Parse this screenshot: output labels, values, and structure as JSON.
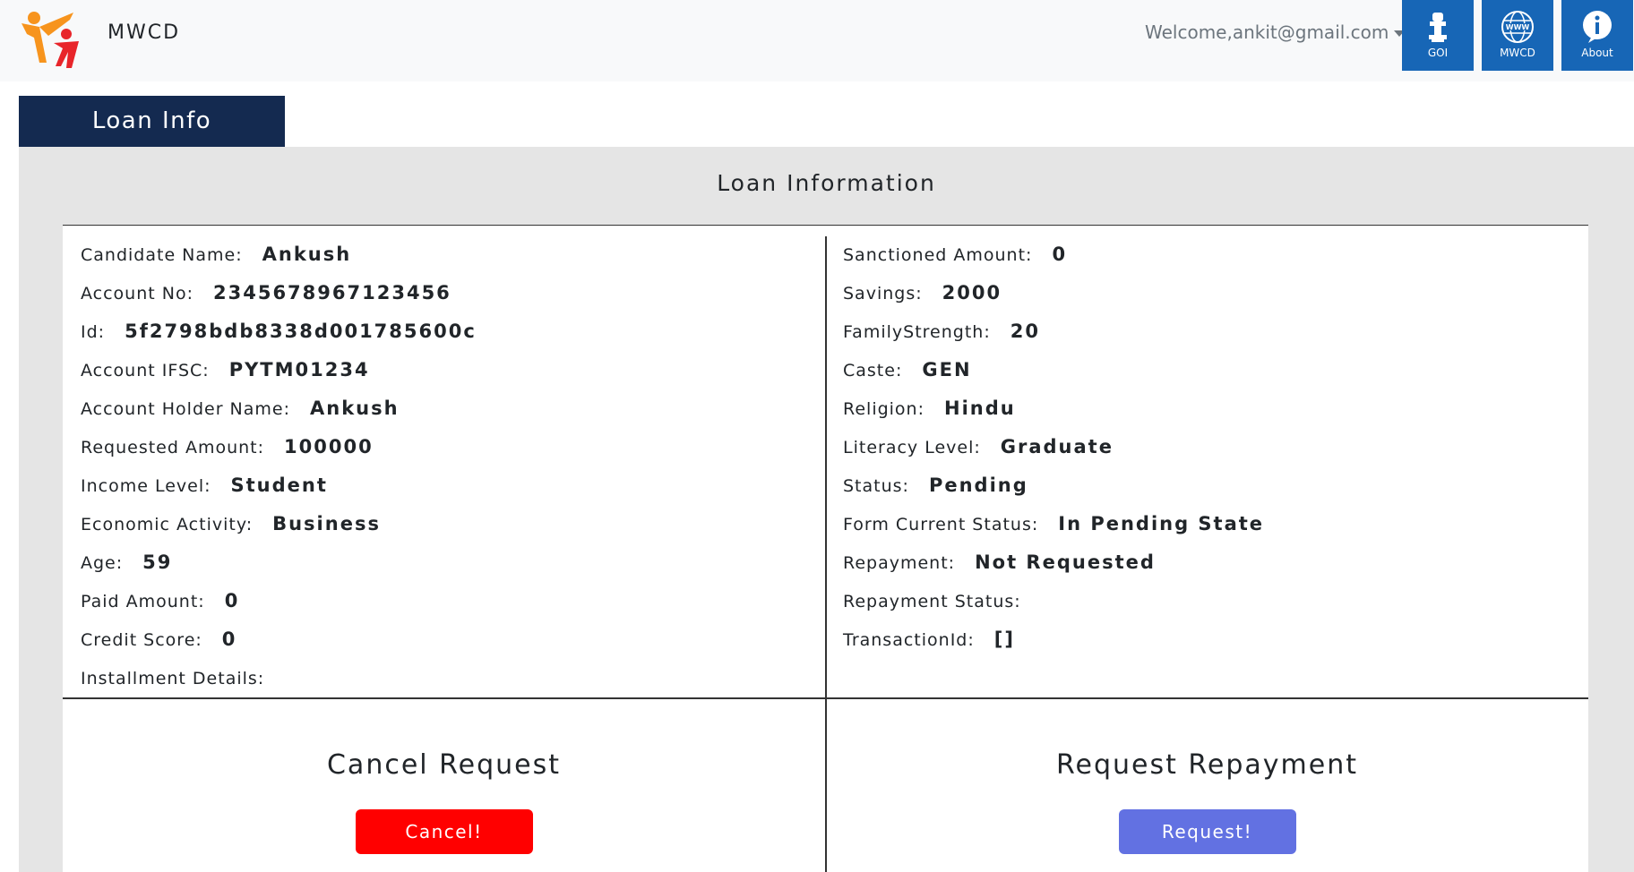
{
  "header": {
    "brand": "MWCD",
    "welcome": "Welcome,ankit@gmail.com",
    "nav": [
      {
        "label": "GOI",
        "icon": "emblem-icon"
      },
      {
        "label": "MWCD",
        "icon": "globe-www-icon"
      },
      {
        "label": "About",
        "icon": "info-icon"
      }
    ]
  },
  "tab": {
    "label": "Loan Info"
  },
  "panel": {
    "title": "Loan Information",
    "left_fields": [
      {
        "label": "Candidate Name:",
        "value": "Ankush"
      },
      {
        "label": "Account No:",
        "value": "2345678967123456"
      },
      {
        "label": "Id:",
        "value": "5f2798bdb8338d001785600c"
      },
      {
        "label": "Account IFSC:",
        "value": "PYTM01234"
      },
      {
        "label": "Account Holder Name:",
        "value": "Ankush"
      },
      {
        "label": "Requested Amount:",
        "value": "100000"
      },
      {
        "label": "Income Level:",
        "value": "Student"
      },
      {
        "label": "Economic Activity:",
        "value": "Business"
      },
      {
        "label": "Age:",
        "value": "59"
      },
      {
        "label": "Paid Amount:",
        "value": "0"
      },
      {
        "label": "Credit Score:",
        "value": "0"
      },
      {
        "label": "Installment Details:",
        "value": ""
      }
    ],
    "right_fields": [
      {
        "label": "Sanctioned Amount:",
        "value": "0"
      },
      {
        "label": "Savings:",
        "value": "2000"
      },
      {
        "label": "FamilyStrength:",
        "value": "20"
      },
      {
        "label": "Caste:",
        "value": "GEN"
      },
      {
        "label": "Religion:",
        "value": "Hindu"
      },
      {
        "label": "Literacy Level:",
        "value": "Graduate"
      },
      {
        "label": "Status:",
        "value": "Pending"
      },
      {
        "label": "Form Current Status:",
        "value": "In Pending State"
      },
      {
        "label": "Repayment:",
        "value": "Not Requested"
      },
      {
        "label": "Repayment Status:",
        "value": ""
      },
      {
        "label": "TransactionId:",
        "value": "[]"
      }
    ],
    "cancel": {
      "title": "Cancel Request",
      "button": "Cancel!"
    },
    "repay": {
      "title": "Request Repayment",
      "button": "Request!"
    }
  },
  "colors": {
    "nav_bg": "#1766b6",
    "tab_bg": "#142a50",
    "cancel_btn": "#ff0000",
    "request_btn": "#6271e2",
    "logo_orange": "#f7941d",
    "logo_red": "#e8252a"
  }
}
